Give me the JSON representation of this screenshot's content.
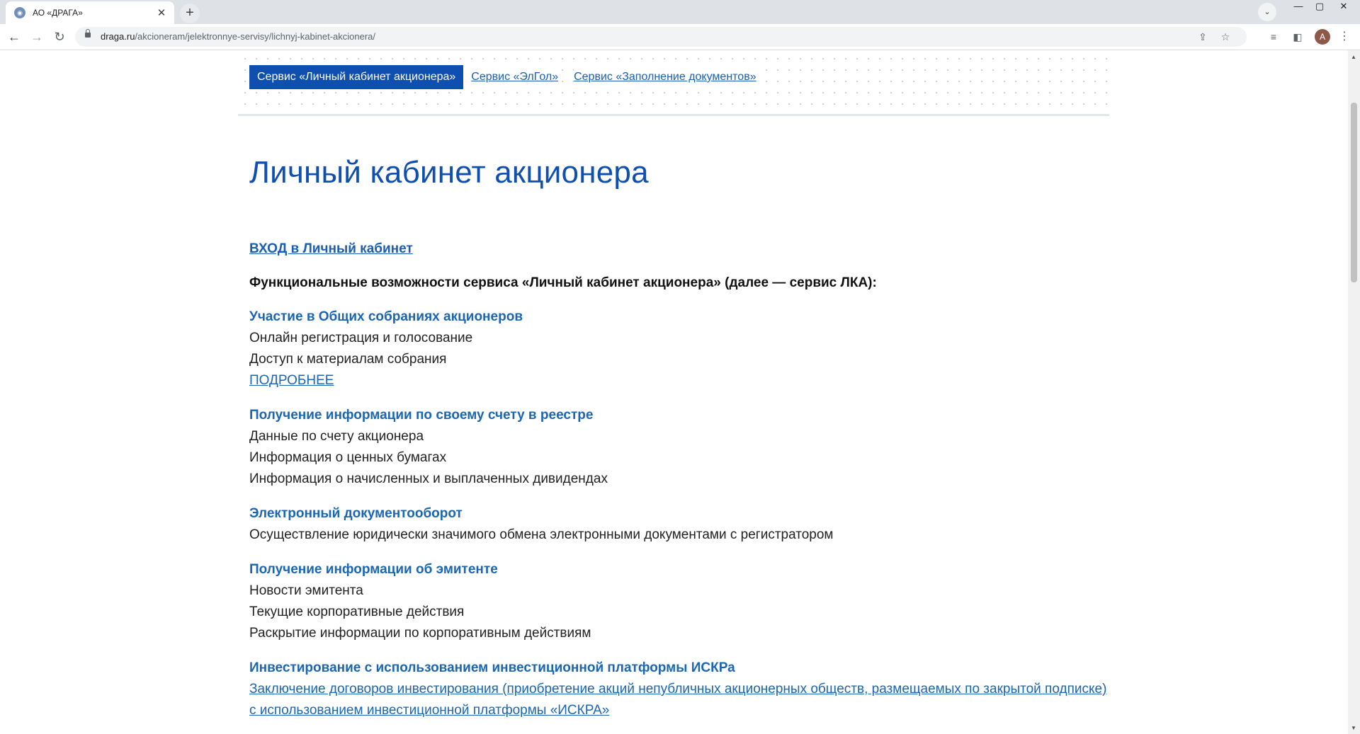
{
  "browser": {
    "tab_title": "АО «ДРАГА»",
    "tab_close": "✕",
    "new_tab": "+",
    "tab_list": "⌄",
    "win_min": "—",
    "win_max": "▢",
    "win_close": "✕",
    "url_host": "draga.ru",
    "url_path": "/akcioneram/jelektronnye-servisy/lichnyj-kabinet-akcionera/",
    "avatar_letter": "A"
  },
  "service_nav": {
    "active": "Сервис «Личный кабинет акционера»",
    "items": [
      "Сервис «ЭлГол»",
      "Сервис «Заполнение документов»"
    ]
  },
  "page": {
    "title": "Личный кабинет акционера",
    "login_link": "ВХОД в Личный кабинет",
    "intro": "Функциональные возможности сервиса «Личный кабинет акционера» (далее — сервис ЛКА):"
  },
  "sections": [
    {
      "title": "Участие в Общих собраниях акционеров",
      "lines": [
        "Онлайн регистрация и голосование",
        "Доступ к материалам собрания"
      ],
      "more": "ПОДРОБНЕЕ"
    },
    {
      "title": "Получение информации по своему счету в реестре",
      "lines": [
        "Данные по счету акционера",
        "Информация о ценных бумагах",
        "Информация о начисленных и выплаченных дивидендах"
      ]
    },
    {
      "title": "Электронный документооборот",
      "lines": [
        "Осуществление юридически значимого обмена электронными документами с регистратором"
      ]
    },
    {
      "title": "Получение информации об эмитенте",
      "lines": [
        "Новости эмитента",
        "Текущие корпоративные действия",
        "Раскрытие информации по корпоративным действиям"
      ]
    },
    {
      "title": "Инвестирование с использованием инвестиционной платформы ИСКРа",
      "link": "Заключение договоров инвестирования (приобретение акций непубличных акционерных обществ, размещаемых по закрытой подписке) с использованием инвестиционной платформы  «ИСКРА»"
    }
  ]
}
